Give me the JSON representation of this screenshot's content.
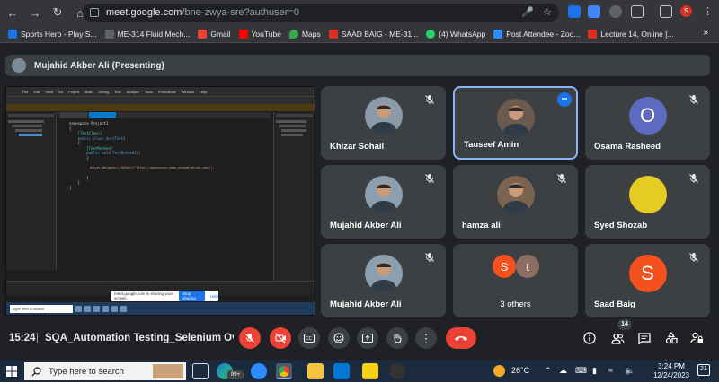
{
  "browser": {
    "url_host": "meet.google.com",
    "url_path": "/bne-zwya-sre?authuser=0",
    "profile_initial": "S"
  },
  "bookmarks": [
    {
      "label": "Sports Hero - Play S...",
      "color": "#1a73e8"
    },
    {
      "label": "ME-314 Fluid Mech...",
      "color": "#5f6368"
    },
    {
      "label": "Gmail",
      "color": "#ea4335"
    },
    {
      "label": "YouTube",
      "color": "#ff0000"
    },
    {
      "label": "Maps",
      "color": "#34a853"
    },
    {
      "label": "SAAD BAIG - ME-31...",
      "color": "#d93025"
    },
    {
      "label": "(4) WhatsApp",
      "color": "#25d366"
    },
    {
      "label": "Post Attendee - Zoo...",
      "color": "#2d8cff"
    },
    {
      "label": "Lecture 14, Online [...",
      "color": "#d93025"
    }
  ],
  "presenter": {
    "label": "Mujahid Akber Ali (Presenting)"
  },
  "presentation": {
    "share_text": "meet.google.com is sharing your screen.",
    "stop_label": "Stop sharing",
    "hide_label": "Hide",
    "mini_search": "Type here to search",
    "code": [
      "namespace Project1",
      "{",
      "    [TestClass]",
      "    public class UnitTest1",
      "    {",
      "        [TestMethod]",
      "        public void TestMethod1()",
      "        {",
      "",
      "            driver.Navigate().GoToUrl(\"https://opensource-demo.orangehrmlive.com/\");",
      "",
      "        }",
      "    }",
      "}"
    ]
  },
  "participants": [
    {
      "name": "Khizar Sohail",
      "type": "photo",
      "bg": "#8a9aa8",
      "muted": true,
      "active": false
    },
    {
      "name": "Tauseef Amin",
      "type": "photo",
      "bg": "#6b5a4e",
      "muted": false,
      "active": true
    },
    {
      "name": "Osama Rasheed",
      "type": "letter",
      "letter": "O",
      "bg": "#5c6bc0",
      "muted": true,
      "active": false
    },
    {
      "name": "Mujahid Akber Ali",
      "type": "photo",
      "bg": "#8aa0b0",
      "muted": true,
      "active": false
    },
    {
      "name": "hamza ali",
      "type": "photo",
      "bg": "#7a6450",
      "muted": true,
      "active": false
    },
    {
      "name": "Syed Shozab",
      "type": "solid",
      "bg": "#e6cb21",
      "muted": true,
      "active": false
    },
    {
      "name": "Mujahid Akber Ali",
      "type": "photo",
      "bg": "#8aa0b0",
      "muted": true,
      "active": false
    },
    {
      "name": "3 others",
      "type": "others",
      "letters": [
        "S",
        "t"
      ],
      "colors": [
        "#f4511e",
        "#8d6e63"
      ],
      "muted": false,
      "active": false
    },
    {
      "name": "Saad Baig",
      "type": "letter",
      "letter": "S",
      "bg": "#f4511e",
      "muted": true,
      "active": false
    }
  ],
  "controls": {
    "time": "15:24",
    "separator": "|",
    "meeting_title": "SQA_Automation Testing_Selenium Over...",
    "people_count": "14"
  },
  "taskbar": {
    "search_placeholder": "Type here to search",
    "temperature": "26°C",
    "time": "3:24 PM",
    "date": "12/24/2023",
    "notif_count": "21",
    "mail_badge": "99+"
  }
}
